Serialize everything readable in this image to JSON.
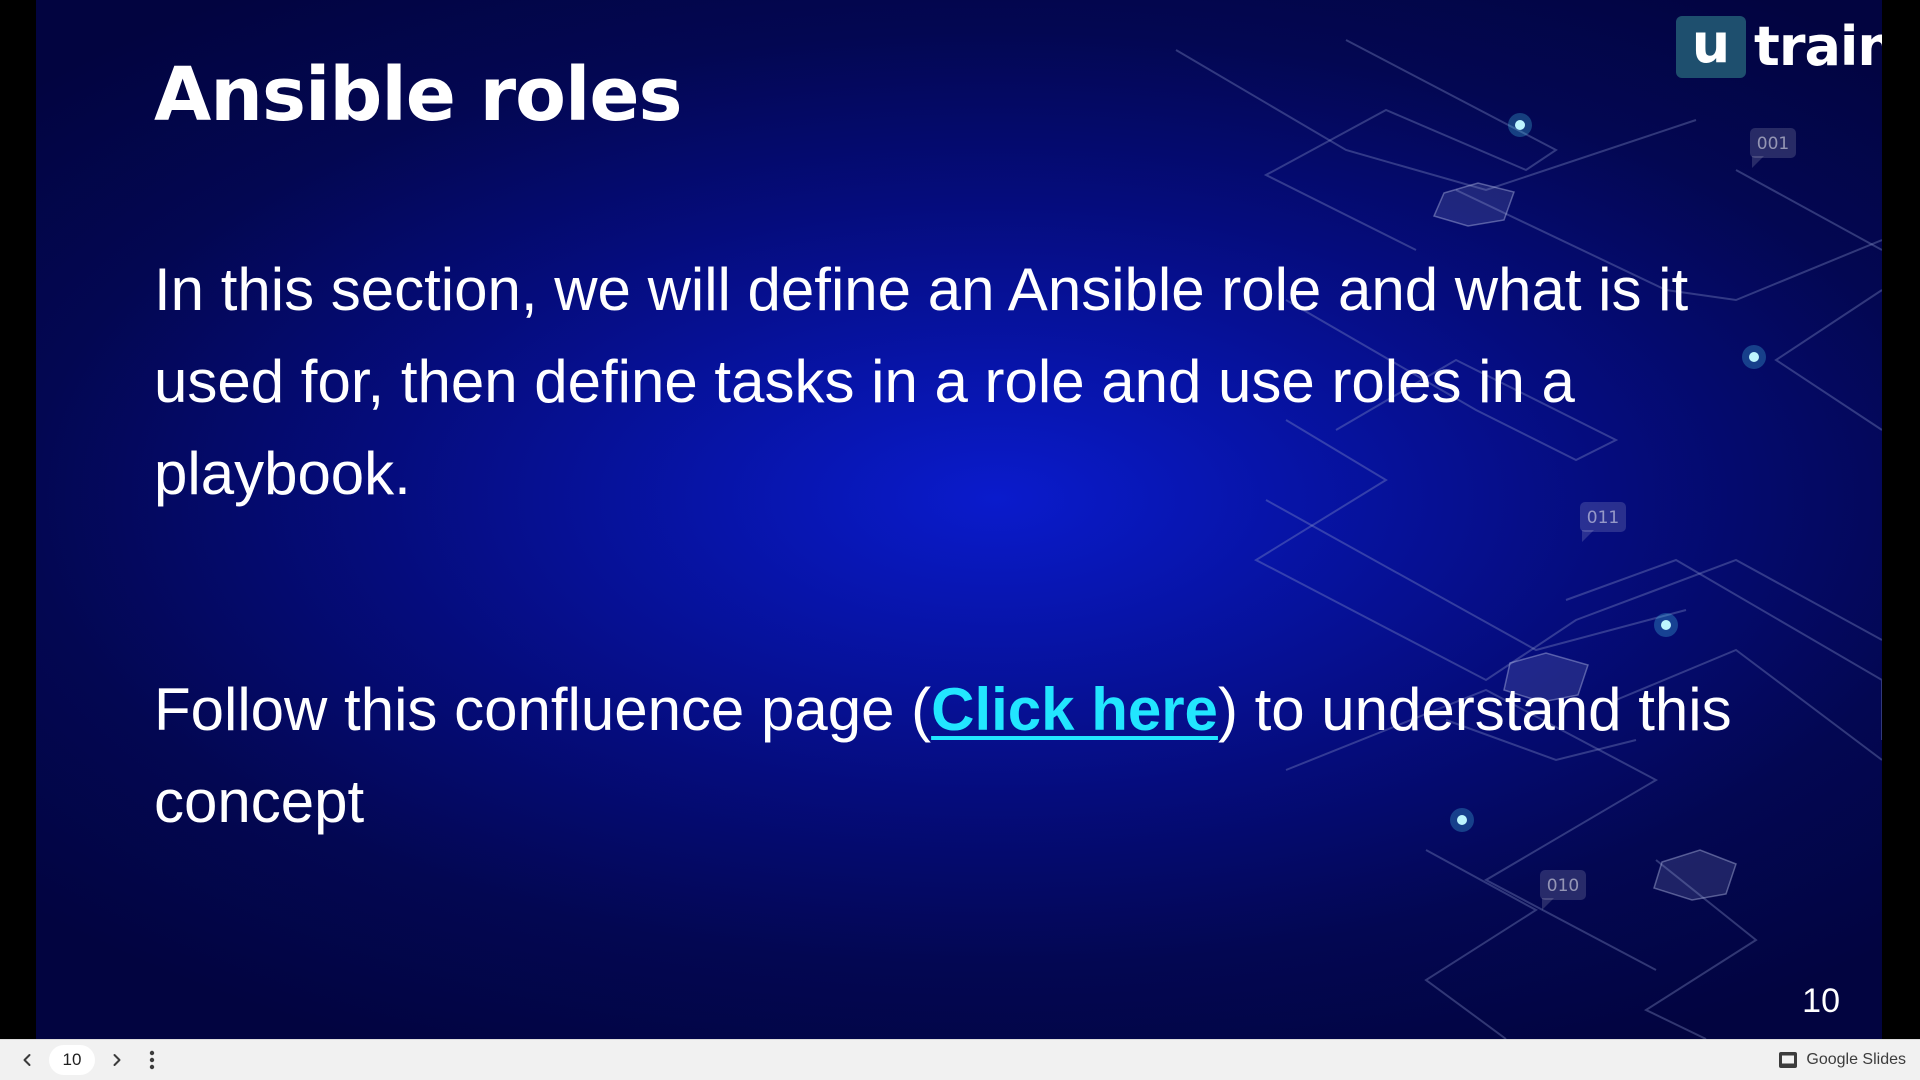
{
  "slide": {
    "title": "Ansible roles",
    "paragraph_1": "In this section, we will define an Ansible role and what is it used for, then define tasks in a role and use roles in a playbook.",
    "paragraph_2_before": "Follow this confluence page (",
    "paragraph_2_link": "Click here",
    "paragraph_2_after": ") to understand this concept",
    "slide_number": "10",
    "logo": {
      "mark": "u",
      "word": "train"
    },
    "decor_tags": [
      "001",
      "011",
      "010"
    ]
  },
  "toolbar": {
    "page_value": "10",
    "prev_icon": "chevron-left-icon",
    "next_icon": "chevron-right-icon",
    "menu_icon": "more-vertical-icon",
    "brand_icon": "slides-icon",
    "brand_label": "Google Slides"
  },
  "colors": {
    "slide_background": "#050c7c",
    "link": "#22e6ff",
    "logo_box": "#1e4f6e",
    "toolbar_background": "#f1f1f1",
    "circuit_lines": "#8a96c8",
    "node_glow": "#4fe6ff"
  }
}
